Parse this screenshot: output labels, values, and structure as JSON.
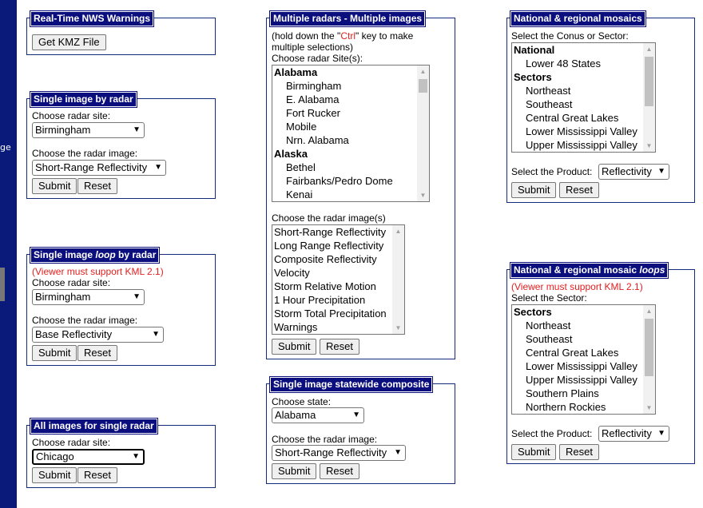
{
  "sidebar": {
    "fragment": "ge"
  },
  "nws": {
    "title": "Real-Time NWS Warnings",
    "kmz_button": "Get KMZ File"
  },
  "single": {
    "title": "Single image by radar",
    "site_label": "Choose radar site:",
    "site_value": "Birmingham",
    "image_label": "Choose the radar image:",
    "image_value": "Short-Range Reflectivity",
    "submit": "Submit",
    "reset": "Reset"
  },
  "loop": {
    "title_pre": "Single image ",
    "title_em": "loop",
    "title_post": " by radar",
    "note": "(Viewer must support KML 2.1)",
    "site_label": "Choose radar site:",
    "site_value": "Birmingham",
    "image_label": "Choose the radar image:",
    "image_value": "Base Reflectivity",
    "submit": "Submit",
    "reset": "Reset"
  },
  "allimg": {
    "title": "All images for single radar",
    "site_label": "Choose radar site:",
    "site_value": "Chicago",
    "submit": "Submit",
    "reset": "Reset"
  },
  "multi": {
    "title": "Multiple radars - Multiple images",
    "hint_pre": "(hold down the \"",
    "hint_key": "Ctrl",
    "hint_post": "\" key to make",
    "hint_line2": "multiple selections)",
    "site_label": "Choose radar Site(s):",
    "sites": [
      {
        "t": "Alabama",
        "g": true
      },
      {
        "t": "Birmingham"
      },
      {
        "t": "E. Alabama"
      },
      {
        "t": "Fort Rucker"
      },
      {
        "t": "Mobile"
      },
      {
        "t": "Nrn. Alabama"
      },
      {
        "t": "Alaska",
        "g": true
      },
      {
        "t": "Bethel"
      },
      {
        "t": "Fairbanks/Pedro Dome"
      },
      {
        "t": "Kenai"
      }
    ],
    "image_label": "Choose the radar image(s)",
    "images": [
      {
        "t": "Short-Range Reflectivity"
      },
      {
        "t": "Long Range Reflectivity"
      },
      {
        "t": "Composite Reflectivity"
      },
      {
        "t": "Velocity"
      },
      {
        "t": "Storm Relative Motion"
      },
      {
        "t": "1 Hour Precipitation"
      },
      {
        "t": "Storm Total Precipitation"
      },
      {
        "t": "Warnings"
      }
    ],
    "submit": "Submit",
    "reset": "Reset"
  },
  "state": {
    "title": "Single image statewide composite",
    "state_label": "Choose state:",
    "state_value": "Alabama",
    "image_label": "Choose the radar image:",
    "image_value": "Short-Range Reflectivity",
    "submit": "Submit",
    "reset": "Reset"
  },
  "mosaic": {
    "title": "National & regional mosaics",
    "sector_label": "Select the Conus or Sector:",
    "sectors": [
      {
        "t": "National",
        "g": true
      },
      {
        "t": "Lower 48 States"
      },
      {
        "t": "Sectors",
        "g": true
      },
      {
        "t": "Northeast"
      },
      {
        "t": "Southeast"
      },
      {
        "t": "Central Great Lakes"
      },
      {
        "t": "Lower Mississippi Valley"
      },
      {
        "t": "Upper Mississippi Valley"
      }
    ],
    "product_label": "Select the Product:",
    "product_value": "Reflectivity",
    "submit": "Submit",
    "reset": "Reset"
  },
  "mloop": {
    "title_pre": "National & regional mosaic ",
    "title_em": "loops",
    "note": "(Viewer must support KML 2.1)",
    "sector_label": "Select the Sector:",
    "sectors": [
      {
        "t": "Sectors",
        "g": true
      },
      {
        "t": "Northeast"
      },
      {
        "t": "Southeast"
      },
      {
        "t": "Central Great Lakes"
      },
      {
        "t": "Lower Mississippi Valley"
      },
      {
        "t": "Upper Mississippi Valley"
      },
      {
        "t": "Southern Plains"
      },
      {
        "t": "Northern Rockies"
      }
    ],
    "product_label": "Select the Product:",
    "product_value": "Reflectivity",
    "submit": "Submit",
    "reset": "Reset"
  }
}
